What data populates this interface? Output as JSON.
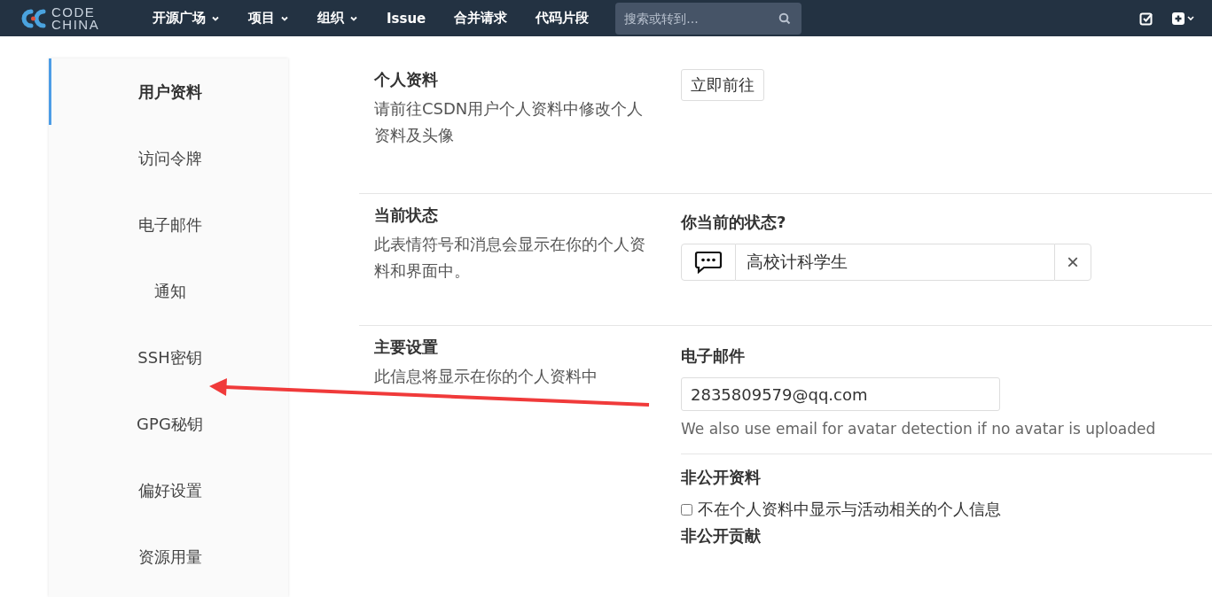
{
  "navbar": {
    "logo_lines": [
      "CODE",
      "CHINA"
    ],
    "items": [
      {
        "label": "开源广场",
        "dropdown": true
      },
      {
        "label": "项目",
        "dropdown": true
      },
      {
        "label": "组织",
        "dropdown": true
      },
      {
        "label": "Issue",
        "dropdown": false
      },
      {
        "label": "合并请求",
        "dropdown": false
      },
      {
        "label": "代码片段",
        "dropdown": false
      }
    ],
    "search": {
      "placeholder": "搜索或转到..."
    }
  },
  "sidebar": {
    "items": [
      {
        "label": "用户资料",
        "selected": true
      },
      {
        "label": "访问令牌",
        "selected": false
      },
      {
        "label": "电子邮件",
        "selected": false
      },
      {
        "label": "通知",
        "selected": false
      },
      {
        "label": "SSH密钥",
        "selected": false
      },
      {
        "label": "GPG秘钥",
        "selected": false
      },
      {
        "label": "偏好设置",
        "selected": false
      },
      {
        "label": "资源用量",
        "selected": false
      }
    ]
  },
  "sections": [
    {
      "title": "个人资料",
      "description": "请前往CSDN用户个人资料中修改个人资料及头像",
      "kind": "button",
      "button": "立即前往"
    },
    {
      "title": "当前状态",
      "description": "此表情符号和消息会显示在你的个人资料和界面中。",
      "kind": "status",
      "label": "你当前的状态?",
      "value": "高校计科学生",
      "clear": "×"
    },
    {
      "title": "主要设置",
      "description": "此信息将显示在你的个人资料中",
      "kind": "settings",
      "email_label": "电子邮件",
      "email": "2835809579@qq.com",
      "email_help": "We also use email for avatar detection if no avatar is uploaded",
      "private_label": "非公开资料",
      "private_option": {
        "label": "不在个人资料中显示与活动相关的个人信息",
        "checked": false
      },
      "contrib_label": "非公开贡献"
    }
  ]
}
